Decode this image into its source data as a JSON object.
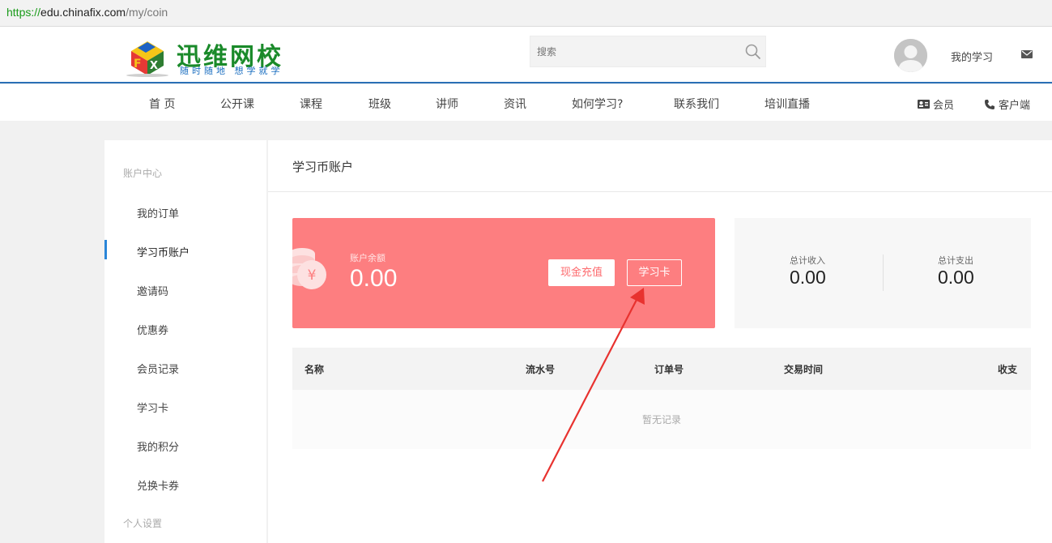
{
  "browser": {
    "url_scheme": "https://",
    "url_domain": "edu.chinafix.com",
    "url_path": "/my/coin"
  },
  "header": {
    "logo_title": "迅维网校",
    "logo_sub": "随时随地 想学就学",
    "search_placeholder": "搜索",
    "my_learning": "我的学习"
  },
  "nav": {
    "items": [
      "首 页",
      "公开课",
      "课程",
      "班级",
      "讲师",
      "资讯",
      "如何学习?",
      "联系我们",
      "培训直播"
    ],
    "member": "会员",
    "client": "客户端"
  },
  "sidebar": {
    "section_account": "账户中心",
    "items": [
      "我的订单",
      "学习币账户",
      "邀请码",
      "优惠券",
      "会员记录",
      "学习卡",
      "我的积分",
      "兑换卡券"
    ],
    "active_index": 1,
    "section_personal": "个人设置"
  },
  "main": {
    "title": "学习币账户",
    "balance_label": "账户余额",
    "balance_value": "0.00",
    "recharge_button": "现金充值",
    "card_button": "学习卡",
    "income_label": "总计收入",
    "income_value": "0.00",
    "expense_label": "总计支出",
    "expense_value": "0.00",
    "columns": [
      "名称",
      "流水号",
      "订单号",
      "交易时间",
      "收支"
    ],
    "empty_text": "暂无记录"
  },
  "colors": {
    "accent_blue": "#2a6fb5",
    "balance_card": "#fd7e80",
    "arrow": "#e8322f"
  }
}
